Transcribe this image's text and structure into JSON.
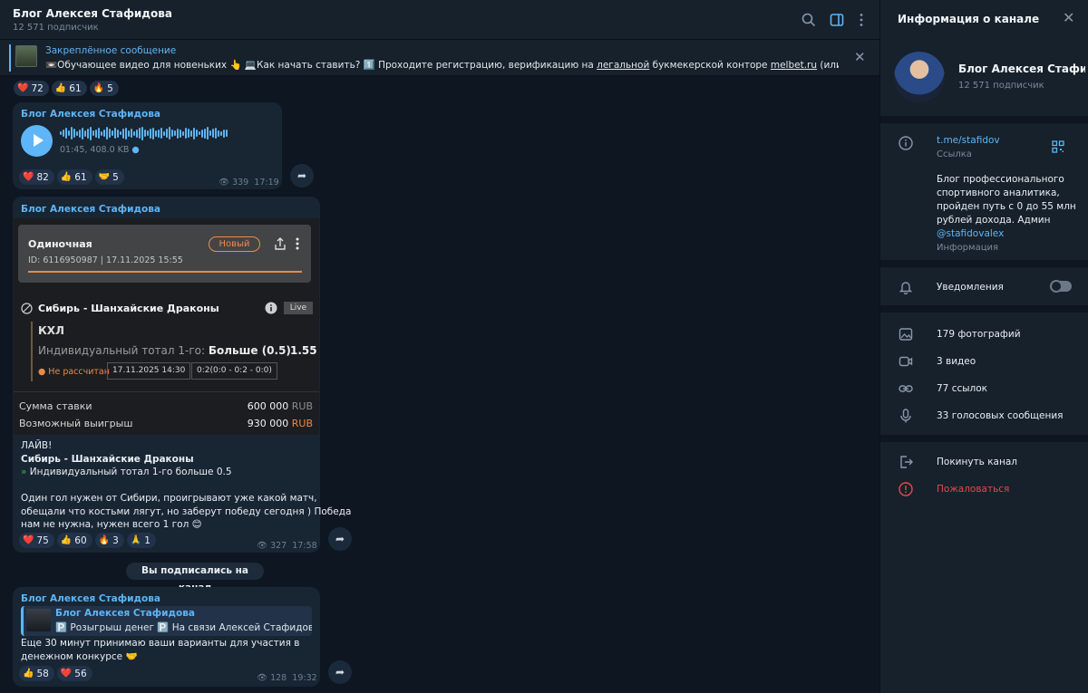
{
  "header": {
    "title": "Блог Алексея Стафидова",
    "subtitle": "12 571 подписчик"
  },
  "pinned": {
    "title": "Закреплённое сообщение",
    "text_before": "📼Обучающее видео для новеньких 👆 💻Как начать ставить? 1️⃣ Проходите регистрацию, верификацию на ",
    "link1": "легальной",
    "text_mid": " букмекерской конторе ",
    "link2": "melbet.ru",
    "text_after": " (или другой, кото..."
  },
  "reactions_top": [
    {
      "emoji": "❤️",
      "count": "72"
    },
    {
      "emoji": "👍",
      "count": "61"
    },
    {
      "emoji": "🔥",
      "count": "5"
    }
  ],
  "voice_msg": {
    "sender": "Блог Алексея Стафидова",
    "duration_size": "01:45, 408.0 KB",
    "reactions": [
      {
        "emoji": "❤️",
        "count": "82"
      },
      {
        "emoji": "👍",
        "count": "61"
      },
      {
        "emoji": "🤝",
        "count": "5"
      }
    ],
    "views": "339",
    "time": "17:19"
  },
  "bet_msg": {
    "sender": "Блог Алексея Стафидова",
    "card": {
      "type": "Одиночная",
      "badge": "Новый",
      "id_date": "ID: 6116950987  |  17.11.2025 15:55",
      "match": "Сибирь - Шанхайские Драконы",
      "live": "Live",
      "league": "КХЛ",
      "market": "Индивидуальный тотал 1-го:",
      "selection": "Больше (0.5)",
      "odd": "1.55",
      "status": "● Не рассчитан",
      "chip_date": "17.11.2025 14:30",
      "chip_score": "0:2(0:0 - 0:2 - 0:0)",
      "stake_label": "Сумма ставки",
      "stake_value": "600 000 ",
      "stake_cur": "RUB",
      "win_label": "Возможный выигрыш",
      "win_value": "930 000 ",
      "win_cur": "RUB"
    },
    "line1": "ЛАЙВ!",
    "line2": "Сибирь - Шанхайские Драконы",
    "line3": "Индивидуальный тотал 1-го больше 0.5",
    "line4": "Один гол нужен от Сибири, проигрывают уже какой матч,",
    "line5": "обещали что костьми лягут, но заберут победу сегодня ) Победа",
    "line6": "нам не нужна, нужен всего 1 гол 😊",
    "reactions": [
      {
        "emoji": "❤️",
        "count": "75"
      },
      {
        "emoji": "👍",
        "count": "60"
      },
      {
        "emoji": "🔥",
        "count": "3"
      },
      {
        "emoji": "🙏",
        "count": "1"
      }
    ],
    "views": "327",
    "time": "17:58"
  },
  "service_msg": "Вы подписались на канал",
  "last_msg": {
    "sender": "Блог Алексея Стафидова",
    "quote_title": "Блог Алексея Стафидова",
    "quote_text": "🅿️ Розыгрыш денег 🅿️  На связи Алексей Стафидов, ад...",
    "line1": "Еще 30 минут принимаю ваши варианты для участия в",
    "line2": "денежном конкурсе 🤝",
    "reactions": [
      {
        "emoji": "👍",
        "count": "58"
      },
      {
        "emoji": "❤️",
        "count": "56"
      }
    ],
    "views": "128",
    "time": "19:32"
  },
  "right_panel": {
    "title": "Информация о канале",
    "name": "Блог Алексея Стафидова",
    "subs": "12 571 подписчик",
    "link": "t.me/stafidov",
    "link_label": "Ссылка",
    "desc_text": "Блог профессионального спортивного аналитика, пройден путь с 0 до 55 млн рублей дохода. Админ",
    "desc_link": "@stafidovalex",
    "desc_label": "Информация",
    "notifications": "Уведомления",
    "photos": "179 фотографий",
    "videos": "3 видео",
    "links": "77 ссылок",
    "voices": "33 голосовых сообщения",
    "leave": "Покинуть канал",
    "report": "Пожаловаться"
  },
  "colors": {
    "accent": "#5eb5f7",
    "danger": "#e5484d",
    "orange": "#e98a4d"
  }
}
